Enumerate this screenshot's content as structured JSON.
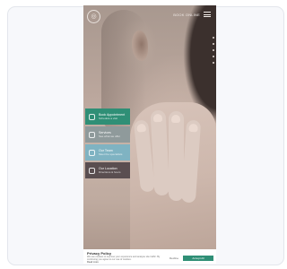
{
  "header": {
    "logo_glyph": "◎",
    "top_link": "BOOK ONLINE",
    "menu_icon": "hamburger-menu-icon"
  },
  "side_tiles": [
    {
      "title": "Book Appointment",
      "subtitle": "Schedule a visit",
      "color": "#2f8f76",
      "icon": "calendar-icon"
    },
    {
      "title": "Services",
      "subtitle": "See what we offer",
      "color": "#8f9a9b",
      "icon": "list-icon"
    },
    {
      "title": "Our Team",
      "subtitle": "Meet the specialists",
      "color": "#7fb3c2",
      "icon": "people-icon"
    },
    {
      "title": "Our Location",
      "subtitle": "Directions & hours",
      "color": "#5a4e50",
      "icon": "pin-icon"
    }
  ],
  "cookie": {
    "title": "Privacy Policy",
    "text": "We use cookies to improve your experience and analyse site traffic. By continuing you agree to our use of cookies.",
    "link": "Read more",
    "decline": "Decline",
    "accept": "Accept All"
  }
}
